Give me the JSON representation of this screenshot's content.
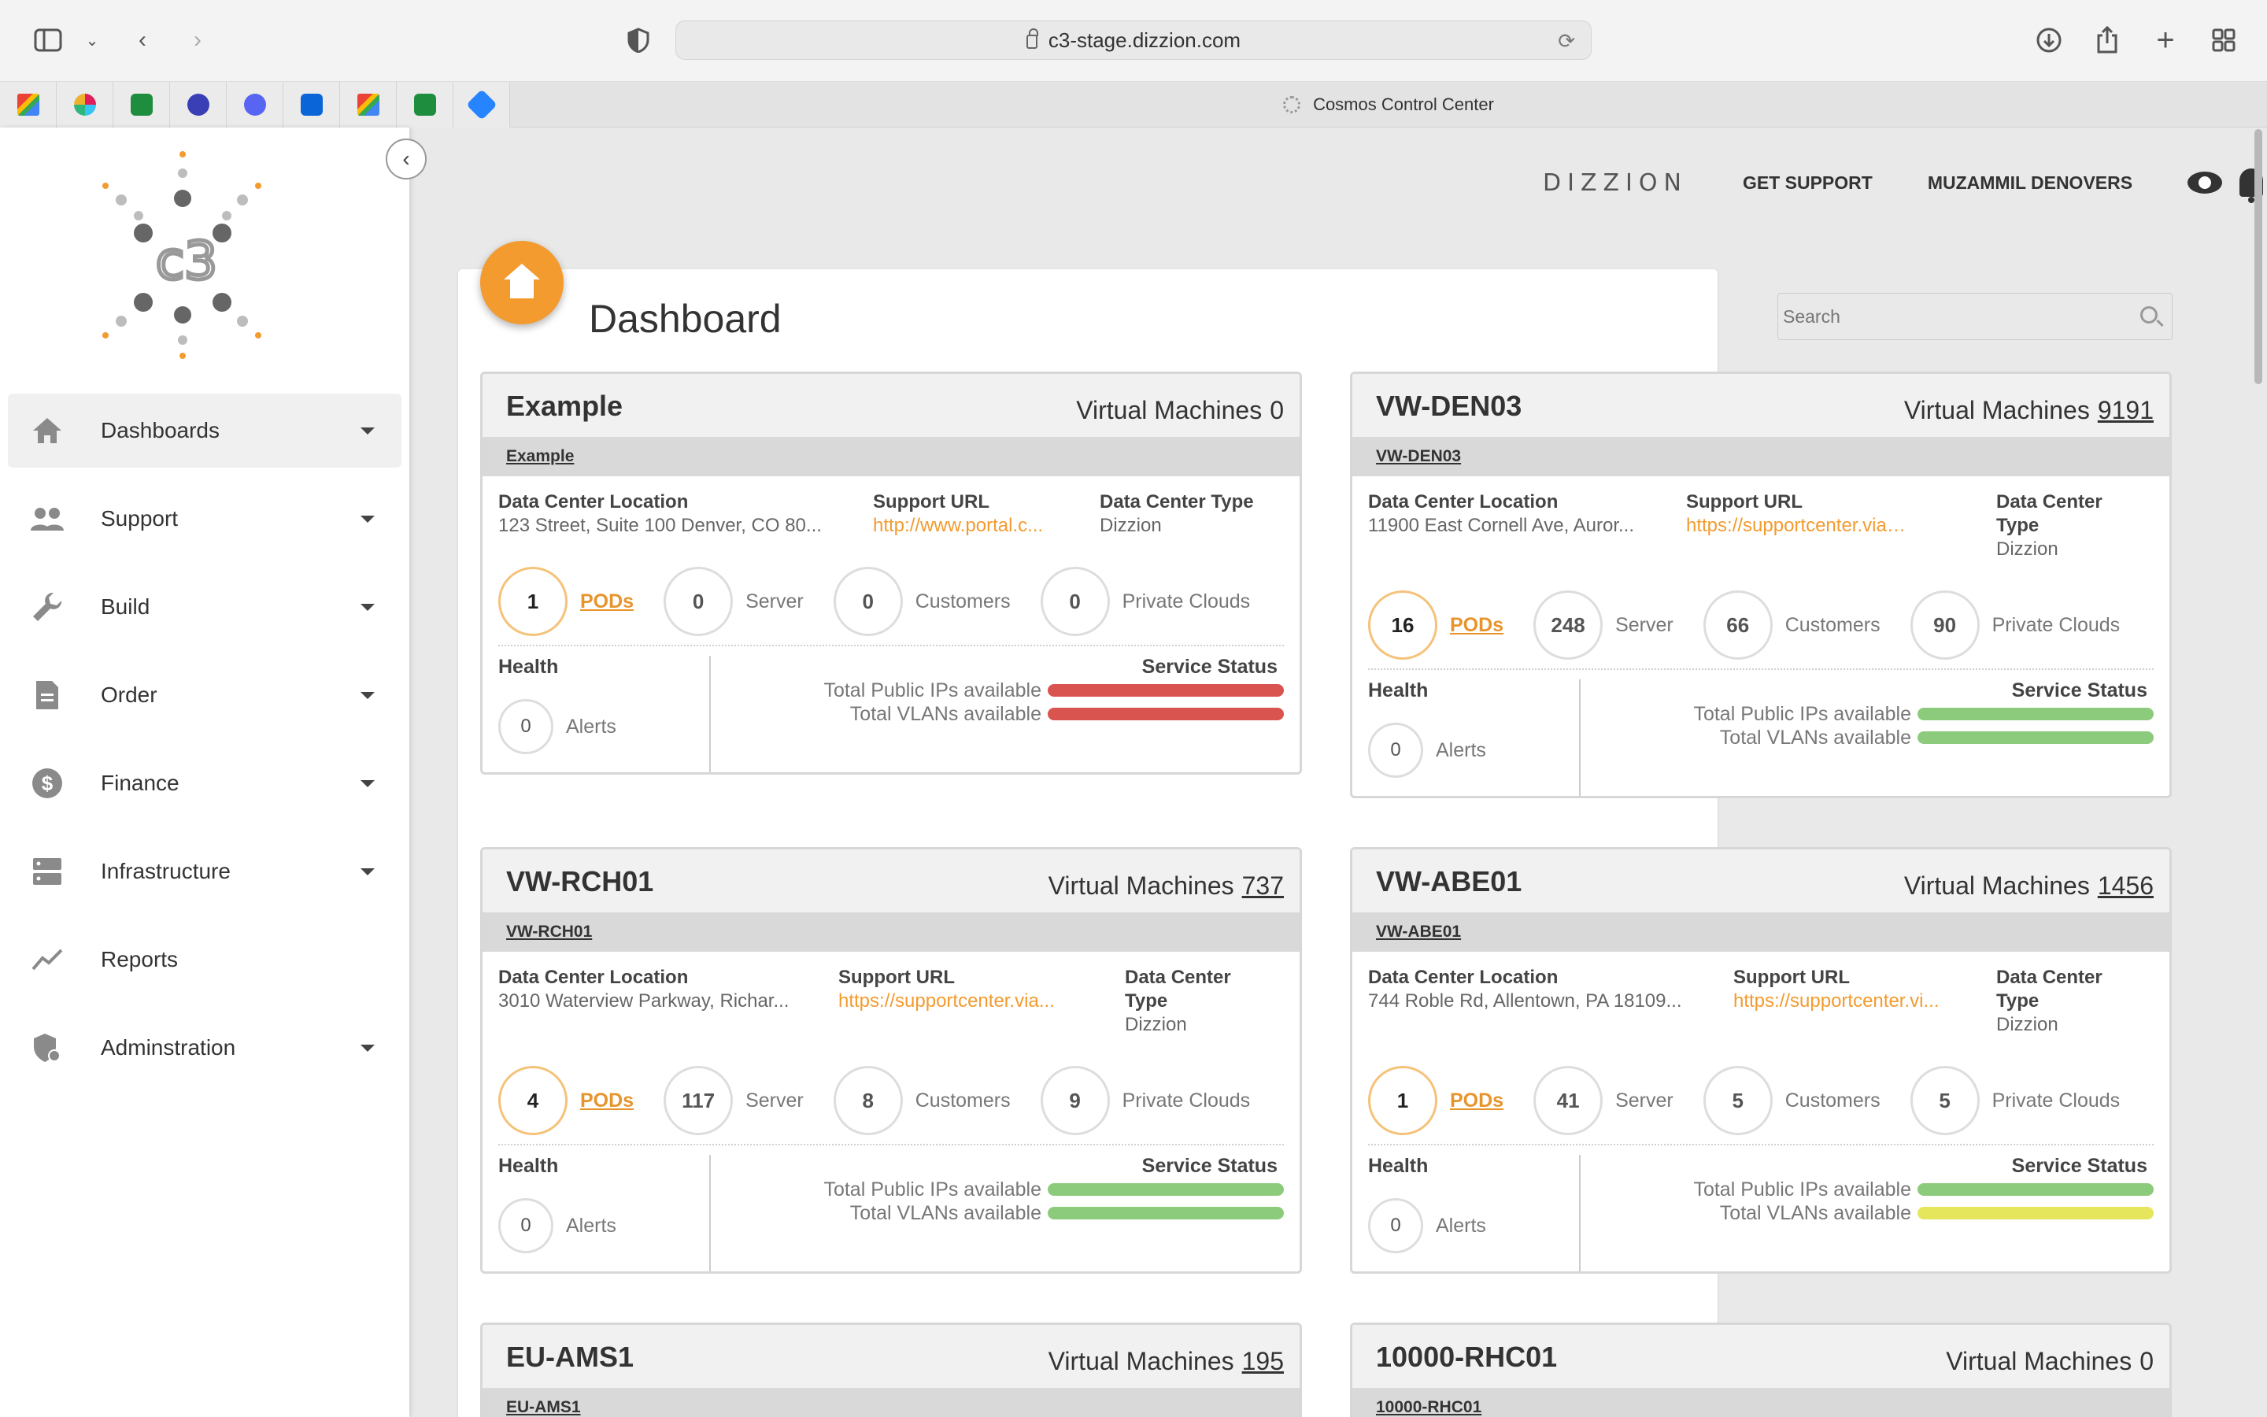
{
  "browser": {
    "url": "c3-stage.dizzion.com",
    "tab_title": "Cosmos Control Center",
    "pinned_tabs": [
      "gmail",
      "slack",
      "sheets",
      "linear",
      "discord",
      "trello",
      "gmail",
      "sheets",
      "jira"
    ]
  },
  "sidebar": {
    "items": [
      {
        "label": "Dashboards",
        "icon": "home-icon"
      },
      {
        "label": "Support",
        "icon": "people-icon"
      },
      {
        "label": "Build",
        "icon": "wrench-icon"
      },
      {
        "label": "Order",
        "icon": "document-icon"
      },
      {
        "label": "Finance",
        "icon": "dollar-icon"
      },
      {
        "label": "Infrastructure",
        "icon": "server-icon"
      },
      {
        "label": "Reports",
        "icon": "chart-icon"
      },
      {
        "label": "Adminstration",
        "icon": "admin-icon"
      }
    ]
  },
  "header": {
    "brand": "DIZZION",
    "support": "GET SUPPORT",
    "user": "MUZAMMIL DENOVERS"
  },
  "page": {
    "title": "Dashboard",
    "search_placeholder": "Search"
  },
  "labels": {
    "vm": "Virtual Machines",
    "loc": "Data Center Location",
    "support_url": "Support URL",
    "dc_type": "Data Center Type",
    "dc_type_line1": "Data Center",
    "dc_type_line2": "Type",
    "pods": "PODs",
    "server": "Server",
    "customers": "Customers",
    "private_clouds": "Private Clouds",
    "health": "Health",
    "alerts": "Alerts",
    "service_status": "Service Status",
    "public_ips": "Total Public IPs available",
    "vlans": "Total VLANs available"
  },
  "cards": [
    {
      "name": "Example",
      "vm": "0",
      "sub": "Example",
      "location": "123 Street, Suite 100 Denver, CO 80...",
      "url": "http://www.portal.c...",
      "type": "Dizzion",
      "pods": "1",
      "server": "0",
      "customers": "0",
      "clouds": "0",
      "alerts": "0",
      "ip_color": "#d9534f",
      "vlan_color": "#d9534f"
    },
    {
      "name": "VW-DEN03",
      "vm": "9191",
      "sub": "VW-DEN03",
      "location": "11900 East Cornell Ave, Auror...",
      "url": "https://supportcenter.viawe...",
      "type": "Dizzion",
      "pods": "16",
      "server": "248",
      "customers": "66",
      "clouds": "90",
      "alerts": "0",
      "ip_color": "#8dcb7c",
      "vlan_color": "#8dcb7c"
    },
    {
      "name": "VW-RCH01",
      "vm": "737",
      "sub": "VW-RCH01",
      "location": "3010 Waterview Parkway, Richar...",
      "url": "https://supportcenter.via...",
      "type": "Dizzion",
      "pods": "4",
      "server": "117",
      "customers": "8",
      "clouds": "9",
      "alerts": "0",
      "ip_color": "#8dcb7c",
      "vlan_color": "#8dcb7c"
    },
    {
      "name": "VW-ABE01",
      "vm": "1456",
      "sub": "VW-ABE01",
      "location": "744 Roble Rd, Allentown, PA 18109...",
      "url": "https://supportcenter.vi...",
      "type": "Dizzion",
      "pods": "1",
      "server": "41",
      "customers": "5",
      "clouds": "5",
      "alerts": "0",
      "ip_color": "#8dcb7c",
      "vlan_color": "#e6e65c"
    },
    {
      "name": "EU-AMS1",
      "vm": "195",
      "sub": "EU-AMS1"
    },
    {
      "name": "10000-RHC01",
      "vm": "0",
      "sub": "10000-RHC01"
    }
  ]
}
